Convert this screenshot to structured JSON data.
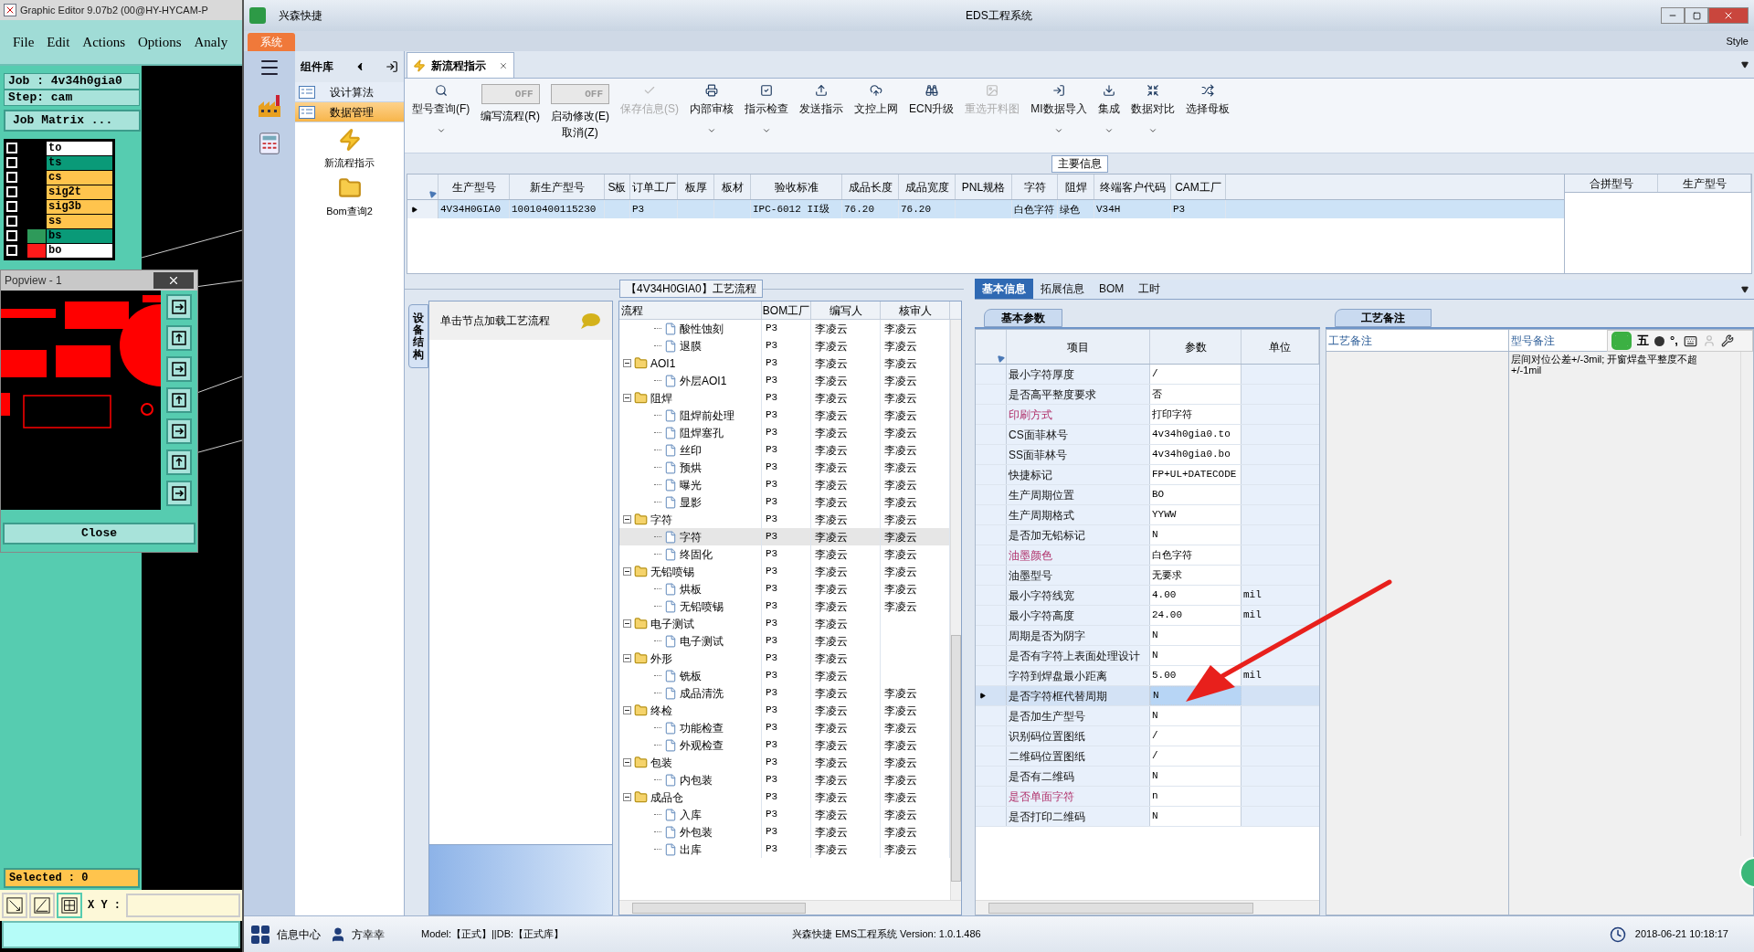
{
  "genesis": {
    "title": "Graphic Editor 9.07b2 (00@HY-HYCAM-P",
    "menu": [
      "File",
      "Edit",
      "Actions",
      "Options",
      "Analy"
    ],
    "job": "Job : 4v34h0gia0",
    "step": "Step: cam",
    "job_matrix": "Job Matrix ...",
    "layers": [
      {
        "name": "to",
        "color": "#ffffff",
        "checked": false
      },
      {
        "name": "ts",
        "color": "#0a9a78",
        "checked": false
      },
      {
        "name": "cs",
        "color": "#ffc44d",
        "checked": false
      },
      {
        "name": "sig2t",
        "color": "#ffc44d",
        "checked": false
      },
      {
        "name": "sig3b",
        "color": "#ffc44d",
        "checked": false
      },
      {
        "name": "ss",
        "color": "#ffc44d",
        "checked": false
      },
      {
        "name": "bs",
        "color": "#0a9a78",
        "checked": false,
        "marker": {
          "color": "#2e9a5a"
        }
      },
      {
        "name": "bo",
        "color": "#ffffff",
        "checked": false,
        "marker": {
          "color": "#ff1a1a"
        }
      }
    ],
    "selected": "Selected : 0",
    "xy_label": "X Y :"
  },
  "popview": {
    "title": "Popview - 1",
    "close": "Close"
  },
  "window": {
    "app_name": "兴森快捷",
    "title": "EDS工程系统",
    "style": "Style"
  },
  "system_tab": "系统",
  "component_panel": {
    "title": "组件库",
    "groups": [
      {
        "label": "设计算法",
        "selected": false
      },
      {
        "label": "数据管理",
        "selected": true
      }
    ],
    "items": [
      {
        "label": "新流程指示",
        "kind": "bolt"
      },
      {
        "label": "Bom查询2",
        "kind": "folder"
      }
    ]
  },
  "doc_tab": {
    "label": "新流程指示"
  },
  "toolbar": [
    {
      "kind": "button",
      "label": "型号查询(F)",
      "dropdown": true,
      "disabled": false
    },
    {
      "kind": "toggle",
      "label": "编写流程(R)",
      "toggle_text": "OFF",
      "on": false
    },
    {
      "kind": "toggle",
      "label": "启动修改(E)",
      "label2": "取消(Z)",
      "toggle_text": "OFF",
      "on": false
    },
    {
      "kind": "button",
      "label": "保存信息(S)",
      "dropdown": false,
      "disabled": true
    },
    {
      "kind": "button",
      "label": "内部审核",
      "dropdown": true,
      "disabled": false
    },
    {
      "kind": "button",
      "label": "指示检查",
      "dropdown": true,
      "disabled": false
    },
    {
      "kind": "button",
      "label": "发送指示",
      "dropdown": false,
      "disabled": false
    },
    {
      "kind": "button",
      "label": "文控上网",
      "dropdown": false,
      "disabled": false
    },
    {
      "kind": "button",
      "label": "ECN升级",
      "dropdown": false,
      "disabled": false
    },
    {
      "kind": "button",
      "label": "重选开料图",
      "dropdown": false,
      "disabled": true
    },
    {
      "kind": "button",
      "label": "MI数据导入",
      "dropdown": true,
      "disabled": false
    },
    {
      "kind": "button",
      "label": "集成",
      "dropdown": true,
      "disabled": false
    },
    {
      "kind": "button",
      "label": "数据对比",
      "dropdown": true,
      "disabled": false
    },
    {
      "kind": "button",
      "label": "选择母板",
      "dropdown": false,
      "disabled": false
    }
  ],
  "main_info": {
    "title": "主要信息",
    "columns": [
      "生产型号",
      "新生产型号",
      "S板",
      "订单工厂",
      "板厚",
      "板材",
      "验收标准",
      "成品长度",
      "成品宽度",
      "PNL规格",
      "字符",
      "阻焊",
      "终端客户代码",
      "CAM工厂"
    ],
    "rows": [
      {
        "selected": true,
        "cells": [
          "4V34H0GIA0",
          "10010400115230",
          null,
          "P3",
          null,
          null,
          "IPC-6012 II级",
          "76.20",
          "76.20",
          null,
          "白色字符",
          "绿色",
          "V34H",
          "P3"
        ]
      }
    ],
    "side_columns": [
      "合拼型号",
      "生产型号"
    ]
  },
  "flow": {
    "title": "【4V34H0GIA0】工艺流程",
    "side_tab": "设备结构",
    "hint": "单击节点加载工艺流程",
    "columns": [
      "流程",
      "BOM工厂",
      "编写人",
      "核审人"
    ],
    "tree": [
      {
        "children": [
          {
            "name": "酸性蚀刻",
            "bom": "P3",
            "writer": "李凌云",
            "reviewer": "李凌云",
            "selected": false
          },
          {
            "name": "退膜",
            "bom": "P3",
            "writer": "李凌云",
            "reviewer": "李凌云",
            "selected": false
          }
        ]
      },
      {
        "name": "AOI1",
        "bom": "P3",
        "writer": "李凌云",
        "reviewer": "李凌云",
        "expanded": true,
        "selected": false,
        "children": [
          {
            "name": "外层AOI1",
            "bom": "P3",
            "writer": "李凌云",
            "reviewer": "李凌云",
            "selected": false
          }
        ]
      },
      {
        "name": "阻焊",
        "bom": "P3",
        "writer": "李凌云",
        "reviewer": "李凌云",
        "expanded": true,
        "selected": false,
        "children": [
          {
            "name": "阻焊前处理",
            "bom": "P3",
            "writer": "李凌云",
            "reviewer": "李凌云",
            "selected": false
          },
          {
            "name": "阻焊塞孔",
            "bom": "P3",
            "writer": "李凌云",
            "reviewer": "李凌云",
            "selected": false
          },
          {
            "name": "丝印",
            "bom": "P3",
            "writer": "李凌云",
            "reviewer": "李凌云",
            "selected": false
          },
          {
            "name": "预烘",
            "bom": "P3",
            "writer": "李凌云",
            "reviewer": "李凌云",
            "selected": false
          },
          {
            "name": "曝光",
            "bom": "P3",
            "writer": "李凌云",
            "reviewer": "李凌云",
            "selected": false
          },
          {
            "name": "显影",
            "bom": "P3",
            "writer": "李凌云",
            "reviewer": "李凌云",
            "selected": false
          }
        ]
      },
      {
        "name": "字符",
        "bom": "P3",
        "writer": "李凌云",
        "reviewer": "李凌云",
        "expanded": true,
        "selected": false,
        "children": [
          {
            "name": "字符",
            "bom": "P3",
            "writer": "李凌云",
            "reviewer": "李凌云",
            "selected": true
          },
          {
            "name": "终固化",
            "bom": "P3",
            "writer": "李凌云",
            "reviewer": "李凌云",
            "selected": false
          }
        ]
      },
      {
        "name": "无铅喷锡",
        "bom": "P3",
        "writer": "李凌云",
        "reviewer": "李凌云",
        "expanded": true,
        "selected": false,
        "children": [
          {
            "name": "烘板",
            "bom": "P3",
            "writer": "李凌云",
            "reviewer": "李凌云",
            "selected": false
          },
          {
            "name": "无铅喷锡",
            "bom": "P3",
            "writer": "李凌云",
            "reviewer": "李凌云",
            "selected": false
          }
        ]
      },
      {
        "name": "电子测试",
        "bom": "P3",
        "writer": "李凌云",
        "expanded": true,
        "selected": false,
        "children": [
          {
            "name": "电子测试",
            "bom": "P3",
            "writer": "李凌云",
            "selected": false
          }
        ]
      },
      {
        "name": "外形",
        "bom": "P3",
        "writer": "李凌云",
        "expanded": true,
        "selected": false,
        "children": [
          {
            "name": "铣板",
            "bom": "P3",
            "writer": "李凌云",
            "selected": false
          },
          {
            "name": "成品清洗",
            "bom": "P3",
            "writer": "李凌云",
            "reviewer": "李凌云",
            "selected": false
          }
        ]
      },
      {
        "name": "终检",
        "bom": "P3",
        "writer": "李凌云",
        "reviewer": "李凌云",
        "expanded": true,
        "selected": false,
        "children": [
          {
            "name": "功能检查",
            "bom": "P3",
            "writer": "李凌云",
            "reviewer": "李凌云",
            "selected": false
          },
          {
            "name": "外观检查",
            "bom": "P3",
            "writer": "李凌云",
            "reviewer": "李凌云",
            "selected": false
          }
        ]
      },
      {
        "name": "包装",
        "bom": "P3",
        "writer": "李凌云",
        "reviewer": "李凌云",
        "expanded": true,
        "selected": false,
        "children": [
          {
            "name": "内包装",
            "bom": "P3",
            "writer": "李凌云",
            "reviewer": "李凌云",
            "selected": false
          }
        ]
      },
      {
        "name": "成品仓",
        "bom": "P3",
        "writer": "李凌云",
        "reviewer": "李凌云",
        "expanded": true,
        "selected": false,
        "children": [
          {
            "name": "入库",
            "bom": "P3",
            "writer": "李凌云",
            "reviewer": "李凌云",
            "selected": false
          },
          {
            "name": "外包装",
            "bom": "P3",
            "writer": "李凌云",
            "reviewer": "李凌云",
            "selected": false
          },
          {
            "name": "出库",
            "bom": "P3",
            "writer": "李凌云",
            "reviewer": "李凌云",
            "selected": false
          }
        ]
      }
    ]
  },
  "detail_tabs": [
    {
      "label": "基本信息",
      "selected": true
    },
    {
      "label": "拓展信息",
      "selected": false
    },
    {
      "label": "BOM",
      "selected": false
    },
    {
      "label": "工时",
      "selected": false
    }
  ],
  "params": {
    "tab": "基本参数",
    "columns": [
      "项目",
      "参数",
      "单位"
    ],
    "rows": [
      {
        "item": "最小字符厚度",
        "value": "/",
        "emphasized": false,
        "selected": false
      },
      {
        "item": "是否高平整度要求",
        "value": "否",
        "emphasized": false,
        "selected": false
      },
      {
        "item": "印刷方式",
        "value": "打印字符",
        "emphasized": true,
        "selected": false
      },
      {
        "item": "CS面菲林号",
        "value": "4v34h0gia0.to",
        "emphasized": false,
        "selected": false
      },
      {
        "item": "SS面菲林号",
        "value": "4v34h0gia0.bo",
        "emphasized": false,
        "selected": false
      },
      {
        "item": "快捷标记",
        "value": "FP+UL+DATECODE",
        "emphasized": false,
        "selected": false
      },
      {
        "item": "生产周期位置",
        "value": "BO",
        "emphasized": false,
        "selected": false
      },
      {
        "item": "生产周期格式",
        "value": "YYWW",
        "emphasized": false,
        "selected": false
      },
      {
        "item": "是否加无铅标记",
        "value": "N",
        "emphasized": false,
        "selected": false
      },
      {
        "item": "油墨颜色",
        "value": "白色字符",
        "emphasized": true,
        "selected": false
      },
      {
        "item": "油墨型号",
        "value": "无要求",
        "emphasized": false,
        "selected": false
      },
      {
        "item": "最小字符线宽",
        "value": "4.00",
        "unit": "mil",
        "emphasized": false,
        "selected": false
      },
      {
        "item": "最小字符高度",
        "value": "24.00",
        "unit": "mil",
        "emphasized": false,
        "selected": false
      },
      {
        "item": "周期是否为阴字",
        "value": "N",
        "emphasized": false,
        "selected": false
      },
      {
        "item": "是否有字符上表面处理设计",
        "value": "N",
        "emphasized": false,
        "selected": false
      },
      {
        "item": "字符到焊盘最小距离",
        "value": "5.00",
        "unit": "mil",
        "emphasized": false,
        "selected": false
      },
      {
        "item": "是否字符框代替周期",
        "value": "N",
        "emphasized": false,
        "selected": true
      },
      {
        "item": "是否加生产型号",
        "value": "N",
        "emphasized": false,
        "selected": false
      },
      {
        "item": "识别码位置图纸",
        "value": "/",
        "emphasized": false,
        "selected": false
      },
      {
        "item": "二维码位置图纸",
        "value": "/",
        "emphasized": false,
        "selected": false
      },
      {
        "item": "是否有二维码",
        "value": "N",
        "emphasized": false,
        "selected": false
      },
      {
        "item": "是否单面字符",
        "value": "n",
        "emphasized": true,
        "selected": false
      },
      {
        "item": "是否打印二维码",
        "value": "N",
        "emphasized": false,
        "selected": false
      }
    ]
  },
  "remarks": {
    "tab": "工艺备注",
    "columns": [
      "工艺备注",
      "型号备注"
    ],
    "text": "层间对位公差+/-3mil; 开窗焊盘平整度不超+/-1mil"
  },
  "ime_bar": {
    "mode": "五",
    "punct": "°,"
  },
  "status_bar": {
    "info_center": "信息中心",
    "user": "方幸幸",
    "model": "Model:【正式】||DB:【正式库】",
    "version": "兴森快捷 EMS工程系统 Version: 1.0.1.486",
    "datetime": "2018-06-21 10:18:17"
  }
}
